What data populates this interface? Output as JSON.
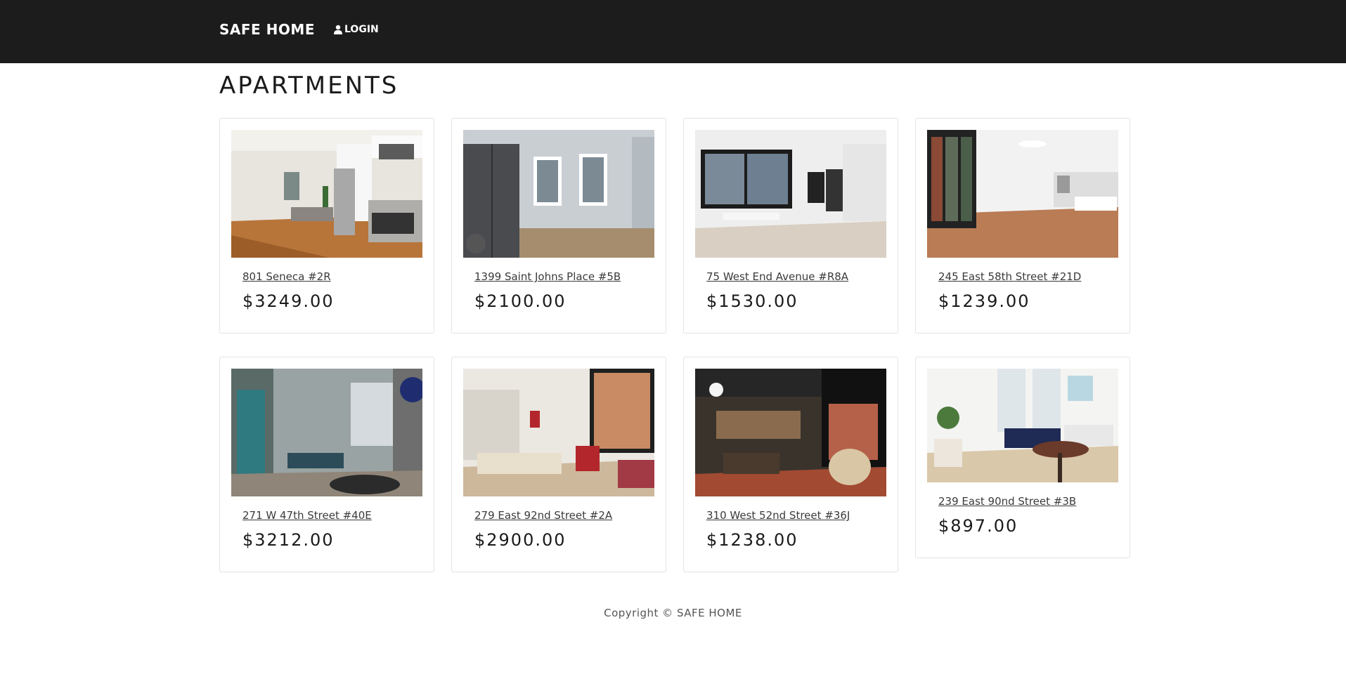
{
  "nav": {
    "brand": "SAFE HOME",
    "login_label": "LOGIN"
  },
  "page": {
    "title": "APARTMENTS"
  },
  "listings": [
    {
      "address": "801 Seneca #2R",
      "price": "$3249.00"
    },
    {
      "address": "1399 Saint Johns Place #5B",
      "price": "$2100.00"
    },
    {
      "address": "75 West End Avenue #R8A",
      "price": "$1530.00"
    },
    {
      "address": "245 East 58th Street #21D",
      "price": "$1239.00"
    },
    {
      "address": "271 W 47th Street #40E",
      "price": "$3212.00"
    },
    {
      "address": "279 East 92nd Street #2A",
      "price": "$2900.00"
    },
    {
      "address": "310 West 52nd Street #36J",
      "price": "$1238.00"
    },
    {
      "address": "239 East 90nd Street #3B",
      "price": "$897.00"
    }
  ],
  "footer": {
    "copyright": "Copyright © SAFE HOME"
  }
}
